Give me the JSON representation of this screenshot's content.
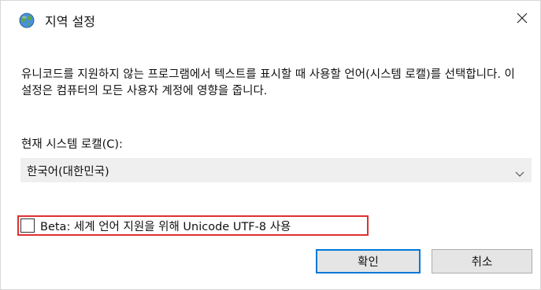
{
  "window": {
    "title": "지역 설정",
    "title_icon": "globe-icon",
    "close_icon": "close-icon"
  },
  "description": "유니코드를 지원하지 않는 프로그램에서 텍스트를 표시할 때 사용할 언어(시스템 로캘)를 선택합니다. 이 설정은 컴퓨터의 모든 사용자 계정에 영향을 줍니다.",
  "locale": {
    "label": "현재 시스템 로캘(C):",
    "selected": "한국어(대한민국)",
    "chevron_icon": "chevron-down-icon"
  },
  "beta": {
    "label": "Beta: 세계 언어 지원을 위해 Unicode UTF-8 사용",
    "checked": false,
    "highlight_color": "#e03030"
  },
  "buttons": {
    "ok": "확인",
    "cancel": "취소"
  },
  "colors": {
    "accent": "#0078d7"
  }
}
